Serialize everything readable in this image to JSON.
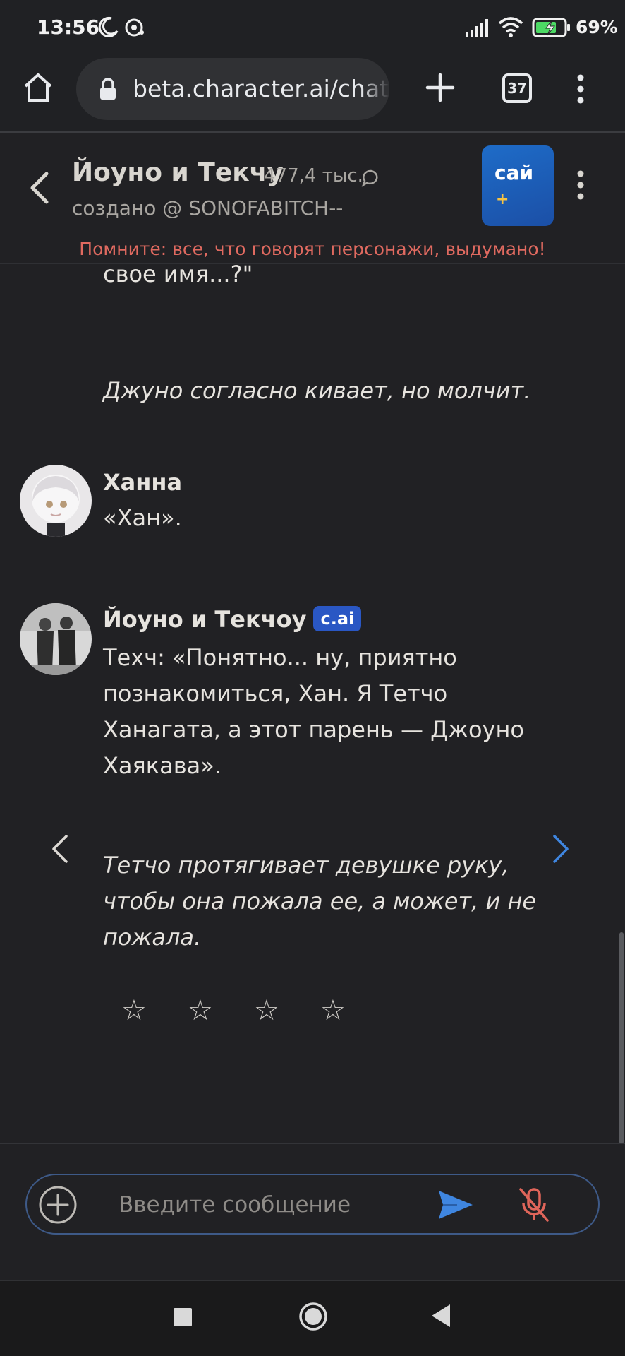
{
  "status_bar": {
    "time": "13:56",
    "battery": "69%",
    "icons": [
      "moon-icon",
      "notification-icon",
      "signal-icon",
      "wifi-icon",
      "battery-charging-icon"
    ]
  },
  "browser": {
    "url": "beta.character.ai/chat",
    "tabs_count": "37",
    "icons": [
      "home-icon",
      "lock-icon",
      "plus-icon",
      "tabs-icon",
      "menu-dots-icon"
    ]
  },
  "chat_header": {
    "character_name": "Йоуно и Текчу",
    "chat_count": "477,4 тыс.",
    "created_by": "создано @ SONOFABITCH--",
    "plus_label": "сай",
    "plus_sign": "+",
    "disclaimer": "Помните: все, что говорят персонажи, выдумано!"
  },
  "messages": {
    "previous_tail": "могли бы вы хотя бы назвать нам свое имя...?\"",
    "previous_italic": "Джуно согласно кивает, но молчит.",
    "user_message": {
      "sender": "Ханна",
      "text": "«Хан»."
    },
    "bot_message": {
      "sender": "Йоуно и Текчоу",
      "badge": "c.ai",
      "text": "Техч: «Понятно... ну, приятно познакомиться, Хан. Я Тетчо Ханагата, а этот парень — Джоуно Хаякава».",
      "italic": "Тетчо протягивает девушке руку, чтобы она пожала ее, а может, и не пожала."
    },
    "rating_stars": [
      "☆",
      "☆",
      "☆",
      "☆"
    ],
    "rating_value": 0
  },
  "composer": {
    "placeholder": "Введите сообщение",
    "value": ""
  },
  "colors": {
    "background": "#212124",
    "accent_blue": "#3f86e0",
    "disclaimer_red": "#e06a60",
    "badge_blue": "#2a57c4",
    "mic_muted_red": "#e0655a"
  }
}
